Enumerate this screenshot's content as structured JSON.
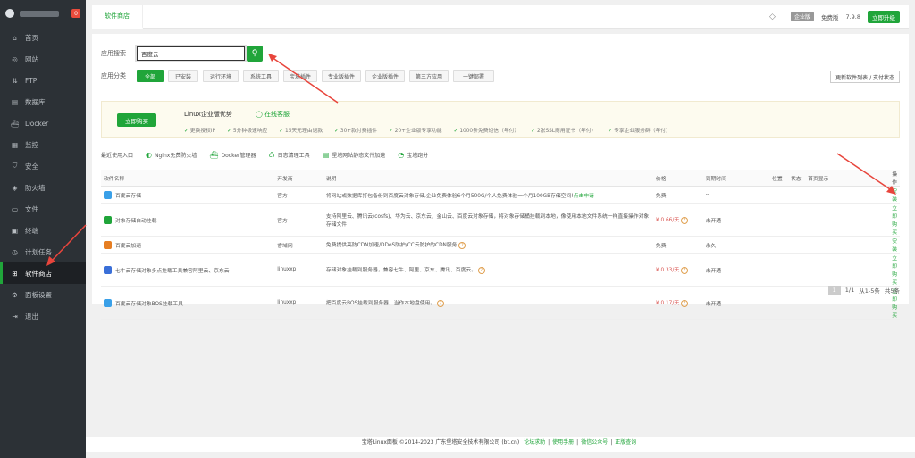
{
  "sidebar": {
    "badge": "0",
    "items": [
      {
        "label": "首页",
        "icon": "home-icon"
      },
      {
        "label": "网站",
        "icon": "globe-icon"
      },
      {
        "label": "FTP",
        "icon": "ftp-icon"
      },
      {
        "label": "数据库",
        "icon": "database-icon"
      },
      {
        "label": "Docker",
        "icon": "docker-icon"
      },
      {
        "label": "监控",
        "icon": "monitor-icon"
      },
      {
        "label": "安全",
        "icon": "shield-icon"
      },
      {
        "label": "防火墙",
        "icon": "firewall-icon"
      },
      {
        "label": "文件",
        "icon": "folder-icon"
      },
      {
        "label": "终端",
        "icon": "terminal-icon"
      },
      {
        "label": "计划任务",
        "icon": "clock-icon"
      },
      {
        "label": "软件商店",
        "icon": "grid-icon",
        "active": true
      },
      {
        "label": "面板设置",
        "icon": "gear-icon"
      },
      {
        "label": "退出",
        "icon": "logout-icon"
      }
    ]
  },
  "topbar": {
    "tab": "软件商店",
    "badge": "企业版",
    "edition": "免费版",
    "version": "7.9.8",
    "upgrade": "立即升级"
  },
  "search": {
    "label": "应用搜索",
    "value": "百度云"
  },
  "categories": {
    "label": "应用分类",
    "items": [
      "全部",
      "已安装",
      "运行环境",
      "系统工具",
      "宝塔插件",
      "专业版插件",
      "企业版插件",
      "第三方应用",
      "一键部署"
    ],
    "update_btn": "更新软件列表 / 支付状态"
  },
  "promo": {
    "buy": "立即购买",
    "title": "Linux企业版优势",
    "service": "在线客服",
    "features": [
      "更换授权IP",
      "5分钟极速响应",
      "15天无理由退款",
      "30+款付费插件",
      "20+企业版专享功能",
      "1000条免费短信（年付）",
      "2张SSL商用证书（年付）",
      "专享企业服务群（年付）"
    ]
  },
  "recent": {
    "label": "最近使用入口",
    "items": [
      "Nginx免费防火墙",
      "Docker管理器",
      "日志清理工具",
      "堡塔网站静态文件加速",
      "宝塔跑分"
    ]
  },
  "table": {
    "headers": [
      "软件名称",
      "开发商",
      "说明",
      "价格",
      "到期时间",
      "位置",
      "状态",
      "首页显示",
      "操作"
    ],
    "rows": [
      {
        "name": "百度云存储",
        "dev": "官方",
        "desc": "将网站或数据库打包备份到百度云对象存储,企业免费体验6个月500G/个人免费体验一个月100GB存储空间!",
        "desc_link": "点击申请",
        "price": "免费",
        "expire": "--",
        "action": "安装",
        "color": "#3aa0e8"
      },
      {
        "name": "对象存储自动挂载",
        "dev": "官方",
        "desc": "支持阿里云、腾讯云(cosfs)、华为云、京东云、金山云、百度云对象存储，将对象存储桶挂载到本地，像使用本地文件系统一样直接操作对象存储文件",
        "price": "¥ 0.66/天",
        "expire": "未开通",
        "action": "立即购买",
        "color": "#20a53a"
      },
      {
        "name": "百度云加速",
        "dev": "睿域网",
        "desc": "免费提供高防CDN加速/DDoS防护/CC云防护的CDN服务",
        "price": "免费",
        "expire": "永久",
        "action": "安装",
        "color": "#e67e22"
      },
      {
        "name": "七牛云存储对象多点挂载工具兼容阿里云、京东云",
        "dev": "linuxxp",
        "desc": "存储对象挂载到服务器，兼容七牛、阿里、京东、腾讯、百度云。",
        "price": "¥ 0.33/天",
        "expire": "未开通",
        "action": "立即购买",
        "color": "#3a6fd8"
      },
      {
        "name": "百度云存储对象BOS挂载工具",
        "dev": "linuxxp",
        "desc": "把百度云BOS挂载到服务器，当作本地盘使用。",
        "price": "¥ 0.17/天",
        "expire": "未开通",
        "action": "立即购买",
        "color": "#3aa0e8"
      }
    ]
  },
  "pager": {
    "current": "1",
    "pages": "1/1",
    "range": "从1-5条",
    "total": "共5条"
  },
  "footer": {
    "copyright": "宝塔Linux面板 ©2014-2023 广东堡塔安全技术有限公司 (bt.cn)",
    "links": [
      "论坛求助",
      "使用手册",
      "微信公众号",
      "正版查询"
    ]
  }
}
